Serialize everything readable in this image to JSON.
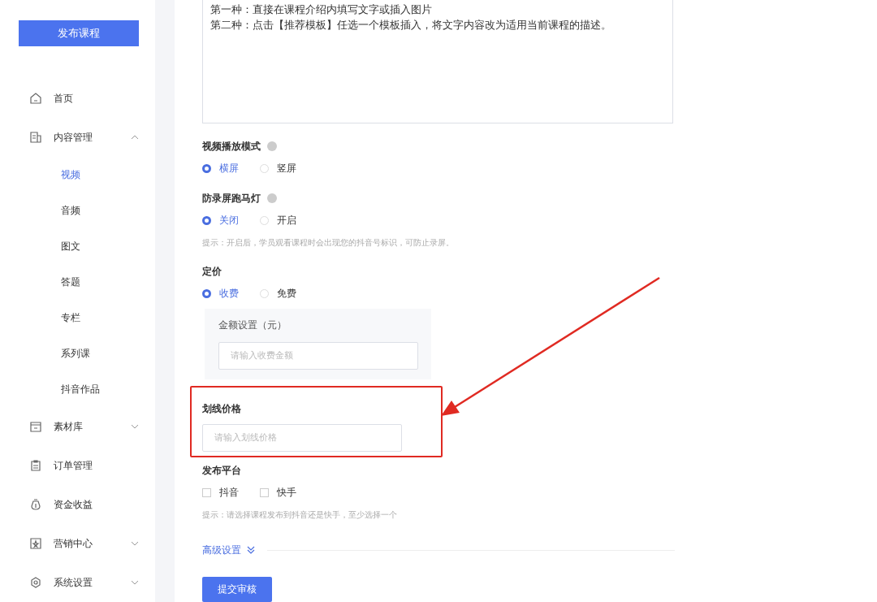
{
  "sidebar": {
    "publish_button": "发布课程",
    "items": [
      {
        "label": "首页"
      },
      {
        "label": "内容管理",
        "expanded": true,
        "children": [
          {
            "label": "视频",
            "selected": true
          },
          {
            "label": "音频",
            "selected": false
          },
          {
            "label": "图文",
            "selected": false
          },
          {
            "label": "答题",
            "selected": false
          },
          {
            "label": "专栏",
            "selected": false
          },
          {
            "label": "系列课",
            "selected": false
          },
          {
            "label": "抖音作品",
            "selected": false
          }
        ]
      },
      {
        "label": "素材库",
        "expanded": false
      },
      {
        "label": "订单管理"
      },
      {
        "label": "资金收益"
      },
      {
        "label": "营销中心",
        "expanded": false
      },
      {
        "label": "系统设置",
        "expanded": false
      }
    ]
  },
  "description": [
    "第一种：直接在课程介绍内填写文字或插入图片",
    "第二种：点击【推荐模板】任选一个模板插入，将文字内容改为适用当前课程的描述。"
  ],
  "radio_groups": [
    {
      "label": "视频播放模式",
      "help": true,
      "options": [
        {
          "label": "横屏",
          "selected": true
        },
        {
          "label": "竖屏",
          "selected": false
        }
      ]
    },
    {
      "label": "防录屏跑马灯",
      "help": true,
      "options": [
        {
          "label": "关闭",
          "selected": true
        },
        {
          "label": "开启",
          "selected": false
        }
      ],
      "hint": "提示：开启后，学员观看课程时会出现您的抖音号标识，可防止录屏。"
    },
    {
      "label": "定价",
      "options": [
        {
          "label": "收费",
          "selected": true
        },
        {
          "label": "免费",
          "selected": false
        }
      ]
    }
  ],
  "amount": {
    "label": "金额设置（元）",
    "placeholder": "请输入收费金额"
  },
  "strike_price": {
    "label": "划线价格",
    "placeholder": "请输入划线价格"
  },
  "platform": {
    "label": "发布平台",
    "options": [
      {
        "label": "抖音",
        "checked": false
      },
      {
        "label": "快手",
        "checked": false
      }
    ],
    "hint": "提示：请选择课程发布到抖音还是快手，至少选择一个"
  },
  "advanced_link": "高级设置",
  "submit_button": "提交审核"
}
